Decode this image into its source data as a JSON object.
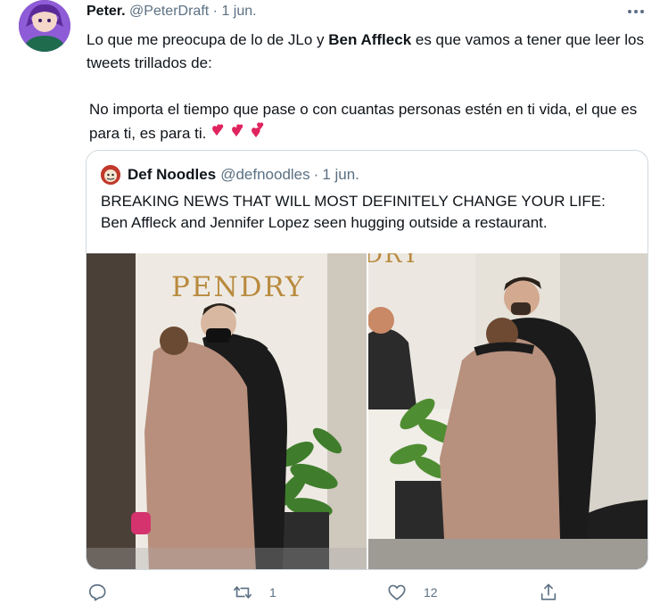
{
  "tweet": {
    "author_name": "Peter.",
    "author_handle": "@PeterDraft",
    "separator": "·",
    "date": "1 jun.",
    "text_part1": "Lo que me preocupa de lo de JLo y ",
    "text_bold": "Ben Affleck",
    "text_part2": " es que vamos a tener que leer los tweets trillados de:",
    "text_para2": "No importa el tiempo que pase o con cuantas personas estén en ti vida, el que es para ti, es para ti."
  },
  "quoted_tweet": {
    "author_name": "Def Noodles",
    "author_handle": "@defnoodles",
    "separator": "·",
    "date": "1 jun.",
    "text": "BREAKING NEWS THAT WILL MOST DEFINITELY CHANGE YOUR LIFE: Ben Affleck and Jennifer Lopez seen hugging outside a restaurant."
  },
  "photos": {
    "left_sign": "PENDRY",
    "right_sign": "DRY"
  },
  "actions": {
    "reply_count": "",
    "retweet_count": "1",
    "like_count": "12"
  },
  "colors": {
    "accent": "#1da1f2",
    "muted": "#5b7083",
    "border": "#cfd9de",
    "heart": "#e0245e"
  },
  "icons": [
    "more-icon",
    "reply-icon",
    "retweet-icon",
    "like-icon",
    "share-icon",
    "hearts-emoji"
  ]
}
